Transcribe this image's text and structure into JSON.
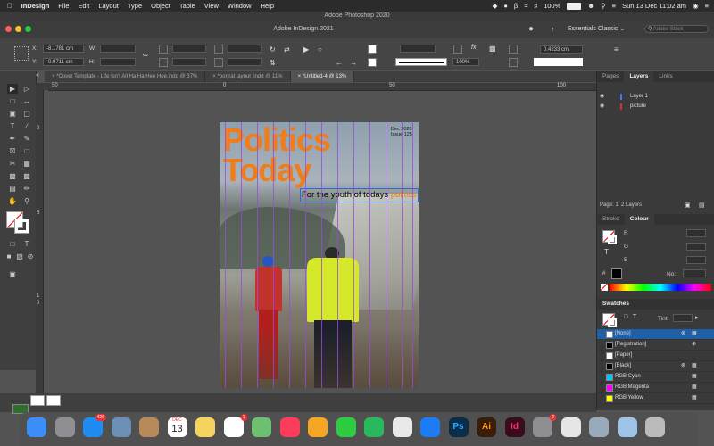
{
  "menubar": {
    "app_name": "InDesign",
    "items": [
      "File",
      "Edit",
      "Layout",
      "Type",
      "Object",
      "Table",
      "View",
      "Window",
      "Help"
    ],
    "battery": "100%",
    "clock": "Sun 13 Dec  11:02 am"
  },
  "photoshop_title": "Adobe Photoshop 2020",
  "indesign_title": "Adobe InDesign 2021",
  "workspace": "Essentials Classic",
  "search_placeholder": "Adobe Stock",
  "control": {
    "x_label": "X:",
    "x_value": "-8.1781 cm",
    "y_label": "Y:",
    "y_value": "-0.9711 cm",
    "w_label": "W:",
    "h_label": "H:",
    "zoom_value": "100%",
    "stroke_weight": "0.4233 cm"
  },
  "doc_tabs": [
    {
      "label": "*Cover Template - Life Isn't All Ha Ha Hee Hee.indd @ 37%",
      "active": false
    },
    {
      "label": "*portrat layout .indd @ 11%",
      "active": false
    },
    {
      "label": "*Untitled-4 @ 13%",
      "active": true
    }
  ],
  "ruler": {
    "h_ticks": [
      "50",
      "0",
      "50",
      "100"
    ],
    "v_ticks": [
      "0",
      "5",
      "1",
      "0"
    ]
  },
  "magazine": {
    "title_line1": "Politics",
    "title_line2": "Today",
    "date": "Dec 2020",
    "issue": "Issue 125",
    "tagline": "For the youth of todays",
    "tagline_accent": "politics"
  },
  "colors": {
    "accent_orange": "#f07c1a",
    "guide_purple": "#9a4bdc",
    "selection_blue": "#1f6fd6"
  },
  "panels": {
    "tabs": [
      "Pages",
      "Layers",
      "Links"
    ],
    "active_tab": "Layers",
    "layers": [
      "Layer 1",
      "picture"
    ],
    "footer": "Page: 1, 2 Layers",
    "color_tabs": [
      "Stroke",
      "Colour"
    ],
    "color_rows": [
      "R",
      "G",
      "B"
    ],
    "hex_label": "No:",
    "swatches_title": "Swatches",
    "tint_label": "Tint:",
    "swatches": [
      {
        "name": "[None]",
        "color": "#ffffff",
        "selected": true
      },
      {
        "name": "[Registration]",
        "color": "#000000",
        "selected": false
      },
      {
        "name": "[Paper]",
        "color": "#ffffff",
        "selected": false
      },
      {
        "name": "[Black]",
        "color": "#000000",
        "selected": false
      },
      {
        "name": "RGB Cyan",
        "color": "#00c8ff",
        "selected": false
      },
      {
        "name": "RGB Magenta",
        "color": "#ff00ff",
        "selected": false
      },
      {
        "name": "RGB Yellow",
        "color": "#ffff00",
        "selected": false
      }
    ]
  },
  "dock": {
    "calendar_month": "DEC",
    "calendar_day": "13",
    "badges": {
      "appstore": "426",
      "reminders": "1",
      "prefs": "2"
    },
    "apps": [
      {
        "name": "finder",
        "color": "#3e8ef7"
      },
      {
        "name": "launchpad",
        "color": "#8e8e93"
      },
      {
        "name": "appstore",
        "color": "#1e8cf0"
      },
      {
        "name": "preview",
        "color": "#6b8fb5"
      },
      {
        "name": "contacts",
        "color": "#b78a5a"
      },
      {
        "name": "calendar",
        "color": "#ffffff"
      },
      {
        "name": "notes",
        "color": "#f4d35e"
      },
      {
        "name": "reminders",
        "color": "#ffffff"
      },
      {
        "name": "maps",
        "color": "#6fbf73"
      },
      {
        "name": "music",
        "color": "#fc3c5a"
      },
      {
        "name": "photos",
        "color": "#f6a623"
      },
      {
        "name": "messages",
        "color": "#2ecc40"
      },
      {
        "name": "facetime",
        "color": "#29b85b"
      },
      {
        "name": "chrome",
        "color": "#e8e8e8"
      },
      {
        "name": "safari",
        "color": "#1b7cf5"
      },
      {
        "name": "photoshop",
        "color": "#0a2e4a"
      },
      {
        "name": "illustrator",
        "color": "#3a1c0a"
      },
      {
        "name": "indesign",
        "color": "#3a0a1e"
      },
      {
        "name": "prefs",
        "color": "#8e8e93"
      },
      {
        "name": "textedit",
        "color": "#e6e6e6"
      },
      {
        "name": "screenshot",
        "color": "#9ab"
      },
      {
        "name": "folder",
        "color": "#9fc3e7"
      },
      {
        "name": "trash",
        "color": "#bbbbbb"
      }
    ],
    "app_labels": {
      "photoshop": "Ps",
      "illustrator": "Ai",
      "indesign": "Id"
    }
  }
}
